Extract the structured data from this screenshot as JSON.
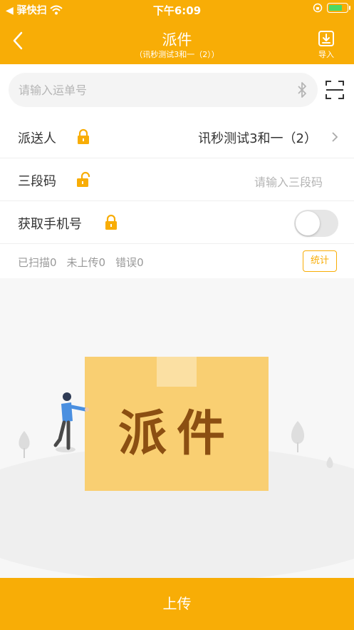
{
  "status_bar": {
    "carrier": "◀ 驿快扫",
    "time": "下午6:09"
  },
  "nav": {
    "title": "派件",
    "subtitle": "（讯秒测试3和一（2））",
    "import_label": "导入"
  },
  "search": {
    "placeholder": "请输入运单号"
  },
  "form": {
    "courier_label": "派送人",
    "courier_value": "讯秒测试3和一（2）",
    "segment_label": "三段码",
    "segment_placeholder": "请输入三段码",
    "phone_label": "获取手机号",
    "phone_toggle_on": false
  },
  "stats": {
    "scanned": "已扫描0",
    "not_uploaded": "未上传0",
    "errors": "错误0",
    "button_label": "统计"
  },
  "illustration": {
    "box_text": "派件"
  },
  "footer": {
    "upload_label": "上传"
  },
  "colors": {
    "accent": "#f8ad06",
    "box": "#f9cf72",
    "box_text": "#8b4f12"
  }
}
